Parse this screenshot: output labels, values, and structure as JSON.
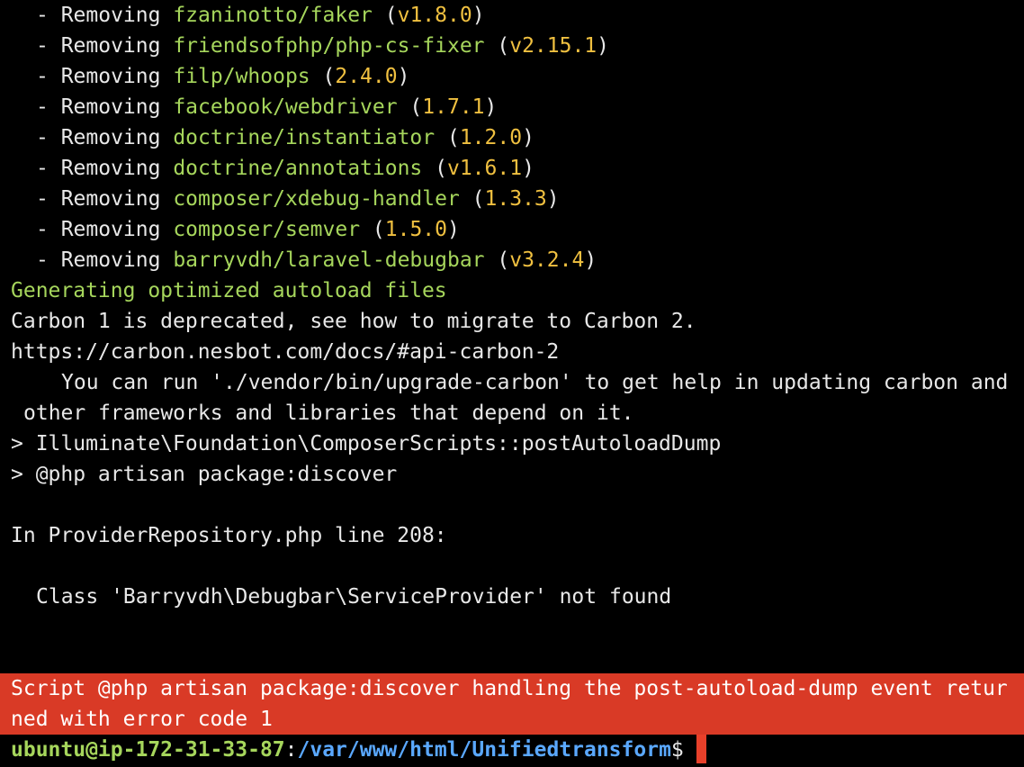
{
  "removals": [
    {
      "prefix": "- Removing ",
      "package": "fzaninotto/faker",
      "version": "v1.8.0"
    },
    {
      "prefix": "- Removing ",
      "package": "friendsofphp/php-cs-fixer",
      "version": "v2.15.1"
    },
    {
      "prefix": "- Removing ",
      "package": "filp/whoops",
      "version": "2.4.0"
    },
    {
      "prefix": "- Removing ",
      "package": "facebook/webdriver",
      "version": "1.7.1"
    },
    {
      "prefix": "- Removing ",
      "package": "doctrine/instantiator",
      "version": "1.2.0"
    },
    {
      "prefix": "- Removing ",
      "package": "doctrine/annotations",
      "version": "v1.6.1"
    },
    {
      "prefix": "- Removing ",
      "package": "composer/xdebug-handler",
      "version": "1.3.3"
    },
    {
      "prefix": "- Removing ",
      "package": "composer/semver",
      "version": "1.5.0"
    },
    {
      "prefix": "- Removing ",
      "package": "barryvdh/laravel-debugbar",
      "version": "v3.2.4"
    }
  ],
  "generating": "Generating optimized autoload files",
  "carbon_line1": "Carbon 1 is deprecated, see how to migrate to Carbon 2.",
  "carbon_line2": "https://carbon.nesbot.com/docs/#api-carbon-2",
  "carbon_line3": "You can run './vendor/bin/upgrade-carbon' to get help in updating carbon and",
  "carbon_line4": "other frameworks and libraries that depend on it.",
  "script_line1": "> Illuminate\\Foundation\\ComposerScripts::postAutoloadDump",
  "script_line2": "> @php artisan package:discover",
  "error_location": "In ProviderRepository.php line 208:",
  "error_message": "Class 'Barryvdh\\Debugbar\\ServiceProvider' not found",
  "error_block": {
    "line1": "Script @php artisan package:discover handling the post-autoload-dump event retur",
    "line2": "ned with error code 1"
  },
  "prompt": {
    "user_host": "ubuntu@ip-172-31-33-87",
    "separator": ":",
    "path": "/var/www/html/Unifiedtransform",
    "symbol": "$"
  },
  "colors": {
    "background": "#000000",
    "package": "#a6d65c",
    "version": "#f0c040",
    "error_bg": "#d93a26",
    "path": "#5aa8ff",
    "cursor": "#e8402a"
  }
}
